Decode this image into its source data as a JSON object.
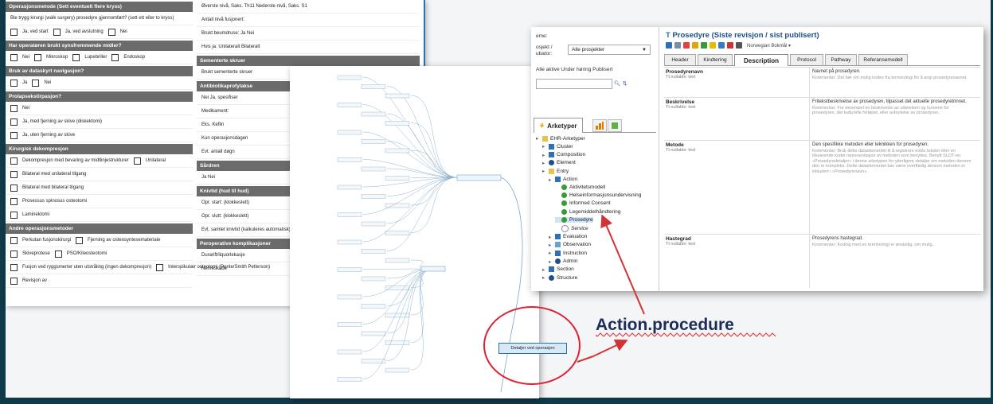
{
  "form": {
    "col1": [
      {
        "type": "sec",
        "text": "Operasjonsmetode (Sett eventuelt flere kryss)"
      },
      {
        "type": "row",
        "text": "Ble trygg kirurgi (walk surgery) prosedyre gjennomført? (sett ett eller to kryss)"
      },
      {
        "type": "row",
        "items": [
          "Ja, ved start",
          "Ja, ved avslutning",
          "Nei"
        ]
      },
      {
        "type": "sec",
        "text": "Har operatøren brukt synsfremmende midler?"
      },
      {
        "type": "row",
        "items": [
          "Nei",
          "Mikroskop",
          "Lupebriller",
          "Endoskop"
        ]
      },
      {
        "type": "sec",
        "text": "Bruk av dataskyrt navigasjon?"
      },
      {
        "type": "row",
        "items": [
          "Ja",
          "Nei"
        ]
      },
      {
        "type": "sec",
        "text": "Prolapsekstirpasjon?"
      },
      {
        "type": "row",
        "items": [
          "Nei"
        ]
      },
      {
        "type": "row",
        "items": [
          "Ja, med fjerning av skive (diskektomi)"
        ]
      },
      {
        "type": "row",
        "items": [
          "Ja, uten fjerning av skive"
        ]
      },
      {
        "type": "sec",
        "text": "Kirurgisk dekompresjon"
      },
      {
        "type": "row",
        "items": [
          "Dekompresjon med bevaring av midtlinjestrukturer",
          "Unilateral"
        ]
      },
      {
        "type": "row",
        "items": [
          "Bilateral med unilateral tilgang"
        ]
      },
      {
        "type": "row",
        "items": [
          "Bilateral med bilateral tilgang"
        ]
      },
      {
        "type": "row",
        "items": [
          "Prosessus spinosus osteotomi"
        ]
      },
      {
        "type": "row",
        "items": [
          "Laminektomi"
        ]
      },
      {
        "type": "sec",
        "text": "Andre operasjonsmetoder"
      },
      {
        "type": "row",
        "items": [
          "Perkutan fusjonskirurgi",
          "Fjerning av osteosyntesemateriale"
        ]
      },
      {
        "type": "row",
        "items": [
          "Skiveprotese",
          "PSO/Kileosteotomi"
        ]
      },
      {
        "type": "row",
        "items": [
          "Fusjon ved ryggsmerter uten utstråling (ingen dekompresjon)",
          "Interspikulær osteotomi (Ponte/Smith Petterson)"
        ]
      },
      {
        "type": "row",
        "items": [
          "Revisjon av"
        ]
      }
    ],
    "col2": [
      {
        "type": "row",
        "text": "Øverste nivå,  Saks. Th11       Nederste nivå,  Saks. S1"
      },
      {
        "type": "row",
        "text": "Antall nivå fusjonert:"
      },
      {
        "type": "row",
        "text": "Brukt beumdruse:   Ja   Nei"
      },
      {
        "type": "row",
        "text": "Hvis ja:   Unilateralt   Bilateralt"
      },
      {
        "type": "sec",
        "text": "Sementerte skruer"
      },
      {
        "type": "row",
        "text": "Brukt sementerte skruer"
      },
      {
        "type": "sec",
        "text": "Antibiotikaprofylakse"
      },
      {
        "type": "row",
        "text": "Nei   Ja, spesifiser"
      },
      {
        "type": "row",
        "text": "Medikament:"
      },
      {
        "type": "row",
        "text": "Eks. Keflin"
      },
      {
        "type": "row",
        "text": "Kun operasjonsdagen"
      },
      {
        "type": "row",
        "text": "Evt. antall døgn"
      },
      {
        "type": "sec",
        "text": "Sårdren"
      },
      {
        "type": "row",
        "text": "Ja   Nei"
      },
      {
        "type": "sec",
        "text": "Knivtid (hud til hud)"
      },
      {
        "type": "row",
        "text": "Opr. start: (klokkeslett)"
      },
      {
        "type": "row",
        "text": "Opr. slutt: (klokkeslett)"
      },
      {
        "type": "row",
        "text": "Evt. samlet knivtid (kalkuleres automatisk)"
      },
      {
        "type": "sec",
        "text": "Peroperative komplikasjoner"
      },
      {
        "type": "row",
        "text": "Durarift/liquorlekasje"
      },
      {
        "type": "row",
        "text": "Nerveskade"
      }
    ]
  },
  "mindmap": {
    "selected_node": "Detaljer ved operasjon"
  },
  "arch": {
    "left": {
      "label_theme": "eme:",
      "label_project": "osjekt / ubator:",
      "project_value": "Alle prosjekter",
      "filter_label": "Alle aktive  Under høring  Publisert",
      "tab_label": "Arketyper",
      "tree": [
        {
          "depth": 0,
          "text": "EHR-Arketyper",
          "kind": "folder"
        },
        {
          "depth": 1,
          "text": "Cluster",
          "kind": "cluster"
        },
        {
          "depth": 1,
          "text": "Composition",
          "kind": "comp"
        },
        {
          "depth": 1,
          "text": "Element",
          "kind": "dot"
        },
        {
          "depth": 1,
          "text": "Entry",
          "kind": "folder"
        },
        {
          "depth": 2,
          "text": "Action",
          "kind": "action"
        },
        {
          "depth": 3,
          "text": "Aktivitetsmodell",
          "kind": "ok"
        },
        {
          "depth": 3,
          "text": "Helseinformasjonsundervisning",
          "kind": "ok"
        },
        {
          "depth": 3,
          "text": "Informed Consent",
          "kind": "ok"
        },
        {
          "depth": 3,
          "text": "Legemiddelhåndtering",
          "kind": "ok"
        },
        {
          "depth": 3,
          "text": "Prosedyre",
          "kind": "ok",
          "selected": true
        },
        {
          "depth": 3,
          "text": "Service",
          "kind": "empty"
        },
        {
          "depth": 2,
          "text": "Evaluation",
          "kind": "box"
        },
        {
          "depth": 2,
          "text": "Observation",
          "kind": "eye"
        },
        {
          "depth": 2,
          "text": "Instruction",
          "kind": "box"
        },
        {
          "depth": 2,
          "text": "Admin",
          "kind": "dot"
        },
        {
          "depth": 1,
          "text": "Section",
          "kind": "sec"
        },
        {
          "depth": 1,
          "text": "Structure",
          "kind": "dot"
        }
      ]
    },
    "right": {
      "title": "Prosedyre (Siste revisjon / sist publisert)",
      "lang": "Norwegian Bokmål",
      "tabs": [
        "Header",
        "Kindtering",
        "Description",
        "Protocol",
        "Pathway",
        "Referansemodell"
      ],
      "active_tab": "Description",
      "rows": [
        {
          "name": "Prosedyrenavn",
          "sub": "Tt nullable: text",
          "desc": "Navnet på prosedyren.",
          "comment": "Kommentar: Det bør om mulig kodes fra terminologi for å angi prosedyrenavnet."
        },
        {
          "name": "Beskrivelse",
          "sub": "Tt nullable: text",
          "desc": "Fritekstbeskrivelse av prosedyren, tilpasset det aktuelle prosedyretrinnet.",
          "comment": "Kommentar: For eksempel en beskrivelse av utførelsen og funnene for prosedyren, det kulturelle forløpet, eller avbrytelse av prosedyren."
        },
        {
          "name": "Metode",
          "sub": "Tt nullable: text",
          "desc": "Den spesifikke metoden eller teknikken for prosedyren.",
          "comment": "Kommentar: Bruk dette dataelementet til å registrere enkle tekster eller en tilsvarende kodet representasjon av metoden som benyttes. Benytt SLOT-en «Prosedyredetaljer» i denne arketypen for ytterligere detaljer om metoden dersom den er kompleks. Dette dataelementet kan være overflødig dersom metoden er inkludert i «Prosedyrenavn»."
        },
        {
          "name": "Hastegrad",
          "sub": "Tt nullable: text",
          "desc": "Prosedyrens hastegrad.",
          "comment": "Kommentar: Koding med en terminologi er ønskelig, om mulig."
        }
      ]
    }
  },
  "annotation": {
    "label": "Action.procedure"
  },
  "colors": {
    "background": "#0f3a4a",
    "accent_red": "#d23333",
    "label_text": "#1d2d5a"
  }
}
